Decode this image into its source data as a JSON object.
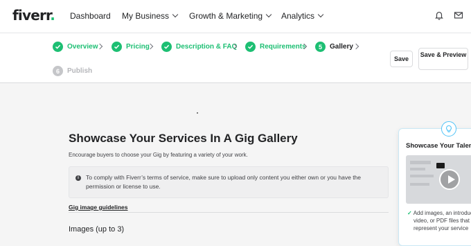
{
  "brand": {
    "name": "fiverr",
    "dot": "."
  },
  "nav": {
    "items": [
      {
        "label": "Dashboard",
        "dropdown": false
      },
      {
        "label": "My Business",
        "dropdown": true
      },
      {
        "label": "Growth & Marketing",
        "dropdown": true
      },
      {
        "label": "Analytics",
        "dropdown": true
      }
    ]
  },
  "steps": [
    {
      "label": "Overview",
      "status": "done"
    },
    {
      "label": "Pricing",
      "status": "done"
    },
    {
      "label": "Description & FAQ",
      "status": "done"
    },
    {
      "label": "Requirements",
      "status": "done"
    },
    {
      "label": "Gallery",
      "status": "active",
      "number": "5"
    },
    {
      "label": "Publish",
      "status": "pending",
      "number": "6"
    }
  ],
  "actions": {
    "save": "Save",
    "save_preview": "Save & Preview"
  },
  "main": {
    "title": "Showcase Your Services In A Gig Gallery",
    "subtitle": "Encourage buyers to choose your Gig by featuring a variety of your work.",
    "notice": "To comply with Fiverr’s terms of service, make sure to upload only content you either own or you have the permission or license to use.",
    "guidelines_link": "Gig image guidelines",
    "images_label": "Images (up to 3)"
  },
  "tip": {
    "title": "Showcase Your Talent",
    "lines": [
      "Add images, an introduction",
      "video, or PDF files that",
      "represent your service"
    ]
  },
  "colors": {
    "accent": "#1dbf73",
    "tip_border": "#4fc3f7"
  }
}
